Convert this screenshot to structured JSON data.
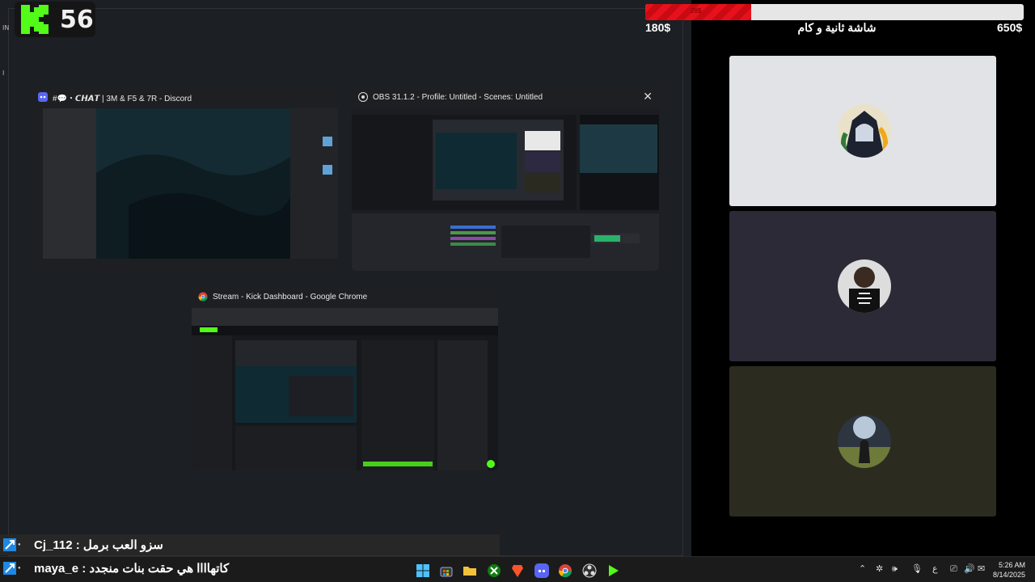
{
  "overlay": {
    "kick_count": "56",
    "progress_label": "28$",
    "progress_fraction": 0.28,
    "money_left": "180$",
    "money_right": "650$",
    "goal_title": "شاشة ثانية و كام"
  },
  "windows": [
    {
      "title": "#💬・𝘾𝙃𝘼𝙏 | 3M & F5 & 7R - Discord",
      "icon": "discord-icon"
    },
    {
      "title": "OBS 31.1.2 - Profile: Untitled - Scenes: Untitled",
      "icon": "obs-icon",
      "close": "✕"
    },
    {
      "title": "Stream - Kick Dashboard - Google Chrome",
      "icon": "chrome-icon"
    }
  ],
  "chat": [
    {
      "user": "Cj_112",
      "message": "سزو العب برمل"
    },
    {
      "user": "maya_e",
      "message": "كاتهاااا هي حقت بنات منجدد"
    }
  ],
  "taskbar": {
    "apps": [
      "windows-start-icon",
      "store-icon",
      "file-explorer-icon",
      "xbox-icon",
      "brave-icon",
      "discord-icon",
      "chrome-icon",
      "obs-icon",
      "kick-icon"
    ],
    "tray_lang": "ع",
    "time": "5:26 AM",
    "date": "8/14/2025"
  },
  "colors": {
    "kick_green": "#53fc18",
    "progress_red": "#e8111b"
  }
}
